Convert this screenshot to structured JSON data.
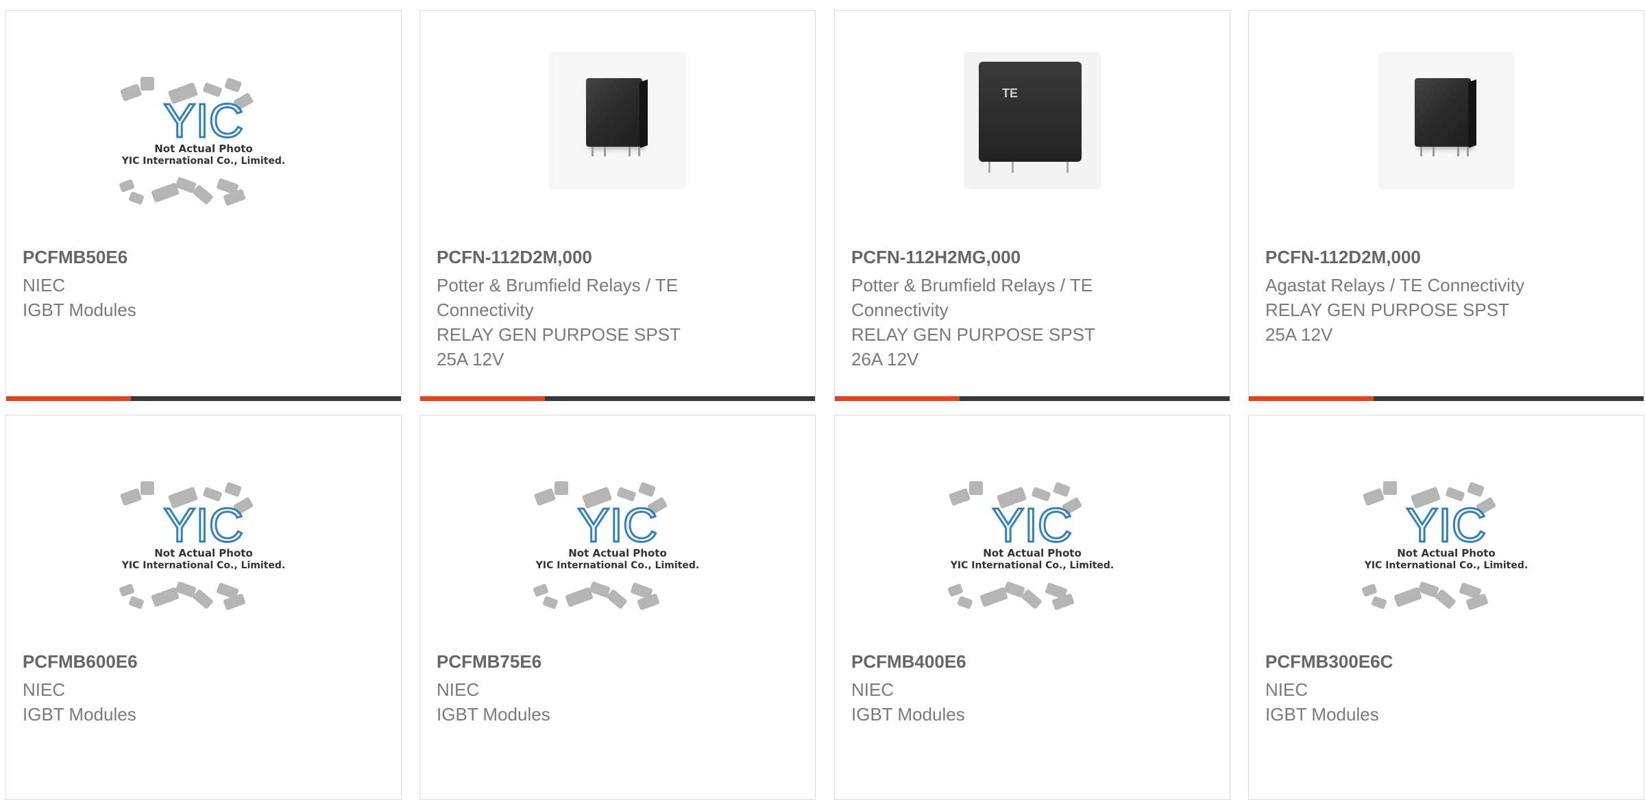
{
  "placeholder": {
    "logo_text": "YIC",
    "line1": "Not Actual Photo",
    "line2": "YIC International Co., Limited."
  },
  "colors": {
    "accent": "#e2451c",
    "bar": "#3a3a3a",
    "logo_blue": "#2f7fc1"
  },
  "products": [
    {
      "part": "PCFMB50E6",
      "lines": [
        "NIEC",
        "IGBT Modules"
      ],
      "image": "placeholder"
    },
    {
      "part": "PCFN-112D2M,000",
      "lines": [
        "Potter & Brumfield Relays / TE",
        "Connectivity",
        "RELAY GEN PURPOSE SPST",
        "25A 12V"
      ],
      "image": "relay"
    },
    {
      "part": "PCFN-112H2MG,000",
      "lines": [
        "Potter & Brumfield Relays / TE",
        "Connectivity",
        "RELAY GEN PURPOSE SPST",
        "26A 12V"
      ],
      "image": "te-relay"
    },
    {
      "part": "PCFN-112D2M,000",
      "lines": [
        "Agastat Relays / TE Connectivity",
        "RELAY GEN PURPOSE SPST",
        "25A 12V"
      ],
      "image": "relay"
    },
    {
      "part": "PCFMB600E6",
      "lines": [
        "NIEC",
        "IGBT Modules"
      ],
      "image": "placeholder"
    },
    {
      "part": "PCFMB75E6",
      "lines": [
        "NIEC",
        "IGBT Modules"
      ],
      "image": "placeholder"
    },
    {
      "part": "PCFMB400E6",
      "lines": [
        "NIEC",
        "IGBT Modules"
      ],
      "image": "placeholder"
    },
    {
      "part": "PCFMB300E6C",
      "lines": [
        "NIEC",
        "IGBT Modules"
      ],
      "image": "placeholder"
    }
  ]
}
